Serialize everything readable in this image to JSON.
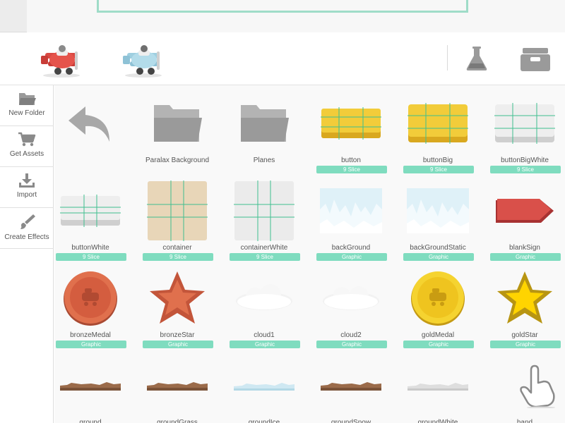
{
  "toolbar": {
    "sprites": [
      "red-plane",
      "blue-plane"
    ]
  },
  "sidebar": {
    "items": [
      {
        "label": "New Folder",
        "icon": "folder-icon"
      },
      {
        "label": "Get Assets",
        "icon": "cart-icon"
      },
      {
        "label": "Import",
        "icon": "download-icon"
      },
      {
        "label": "Create Effects",
        "icon": "brush-icon"
      }
    ]
  },
  "assets": [
    {
      "name": "",
      "badge": "",
      "icon": "back-arrow"
    },
    {
      "name": "Paralax Background",
      "badge": "",
      "icon": "folder"
    },
    {
      "name": "Planes",
      "badge": "",
      "icon": "folder"
    },
    {
      "name": "button",
      "badge": "9 Slice",
      "icon": "yellow-9slice"
    },
    {
      "name": "buttonBig",
      "badge": "9 Slice",
      "icon": "yellow-big-9slice"
    },
    {
      "name": "buttonBigWhite",
      "badge": "9 Slice",
      "icon": "white-big-9slice"
    },
    {
      "name": "buttonWhite",
      "badge": "9 Slice",
      "icon": "white-9slice"
    },
    {
      "name": "container",
      "badge": "9 Slice",
      "icon": "tan-9slice"
    },
    {
      "name": "containerWhite",
      "badge": "9 Slice",
      "icon": "grey-9slice"
    },
    {
      "name": "backGround",
      "badge": "Graphic",
      "icon": "ice-bg"
    },
    {
      "name": "backGroundStatic",
      "badge": "Graphic",
      "icon": "ice-bg"
    },
    {
      "name": "blankSign",
      "badge": "Graphic",
      "icon": "red-sign"
    },
    {
      "name": "bronzeMedal",
      "badge": "Graphic",
      "icon": "bronze-medal"
    },
    {
      "name": "bronzeStar",
      "badge": "Graphic",
      "icon": "bronze-star"
    },
    {
      "name": "cloud1",
      "badge": "Graphic",
      "icon": "cloud"
    },
    {
      "name": "cloud2",
      "badge": "Graphic",
      "icon": "cloud"
    },
    {
      "name": "goldMedal",
      "badge": "Graphic",
      "icon": "gold-medal"
    },
    {
      "name": "goldStar",
      "badge": "Graphic",
      "icon": "gold-star"
    },
    {
      "name": "ground",
      "badge": "",
      "icon": "ground-dirt"
    },
    {
      "name": "groundGrass",
      "badge": "",
      "icon": "ground-dirt"
    },
    {
      "name": "groundIce",
      "badge": "",
      "icon": "ground-ice"
    },
    {
      "name": "groundSnow",
      "badge": "",
      "icon": "ground-dirt"
    },
    {
      "name": "groundWhite",
      "badge": "",
      "icon": "ground-white"
    },
    {
      "name": "hand",
      "badge": "",
      "icon": "hand"
    }
  ],
  "colors": {
    "accent": "#7fdcbf",
    "yellow": "#f2cc3a",
    "bronze": "#e0704d",
    "gold": "#f5d330"
  }
}
